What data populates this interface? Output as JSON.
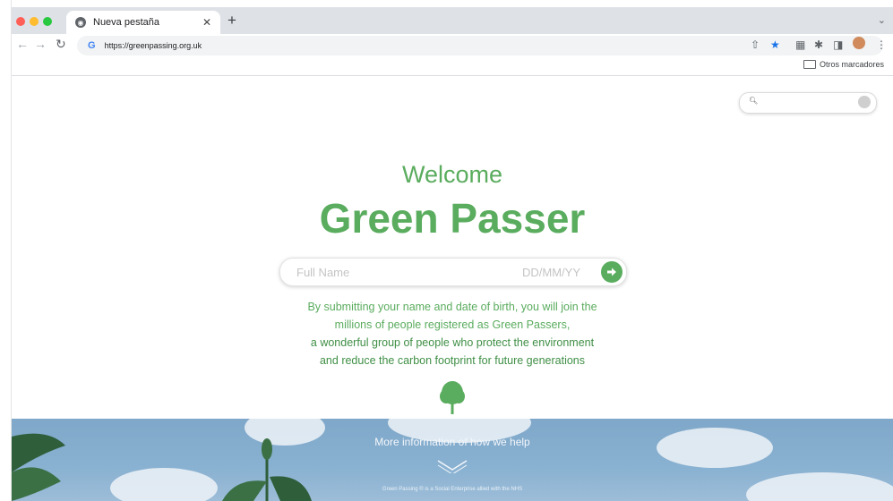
{
  "browser": {
    "tab_title": "Nueva pestaña",
    "url": "https://greenpassing.org.uk",
    "bookmarks_folder": "Otros marcadores"
  },
  "page": {
    "welcome": "Welcome",
    "brand": "Green Passer",
    "form": {
      "name_placeholder": "Full Name",
      "dob_placeholder": "DD/MM/YY"
    },
    "copy_lines": [
      "By submitting your name and date of birth, you will join the",
      "millions of people registered as Green Passers,",
      "a wonderful group of people who protect the environment",
      "and reduce the carbon footprint for future generations"
    ],
    "footer": {
      "more_info": "More information of how we help",
      "footnote": "Green Passing ® is a Social Enterprise allied with the NHS"
    }
  },
  "colors": {
    "brand_green": "#5aac5e",
    "sky_blue": "#89b1d1"
  },
  "icons": [
    "close-icon",
    "plus-icon",
    "back-arrow-icon",
    "forward-arrow-icon",
    "reload-icon",
    "google-icon",
    "share-icon",
    "star-icon",
    "extensions-icon",
    "sidebar-icon",
    "profile-avatar",
    "kebab-menu-icon",
    "folder-icon",
    "search-icon",
    "arrow-right-icon",
    "tree-icon",
    "chevron-down-icon"
  ]
}
